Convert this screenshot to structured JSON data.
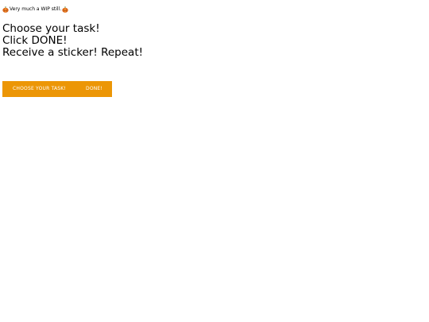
{
  "banner": {
    "text": "Very much a WIP still.",
    "icon_left": "pumpkin-icon",
    "icon_right": "pumpkin-icon"
  },
  "instructions": [
    "Choose your task!",
    "Click DONE!",
    "Receive a sticker! Repeat!"
  ],
  "actions": {
    "choose_label": "CHOOSE YOUR TASK!",
    "done_label": "DONE!"
  },
  "colors": {
    "button_bar": "#ec9606",
    "button_text": "#ffffff",
    "pumpkin": "#d9661a"
  }
}
